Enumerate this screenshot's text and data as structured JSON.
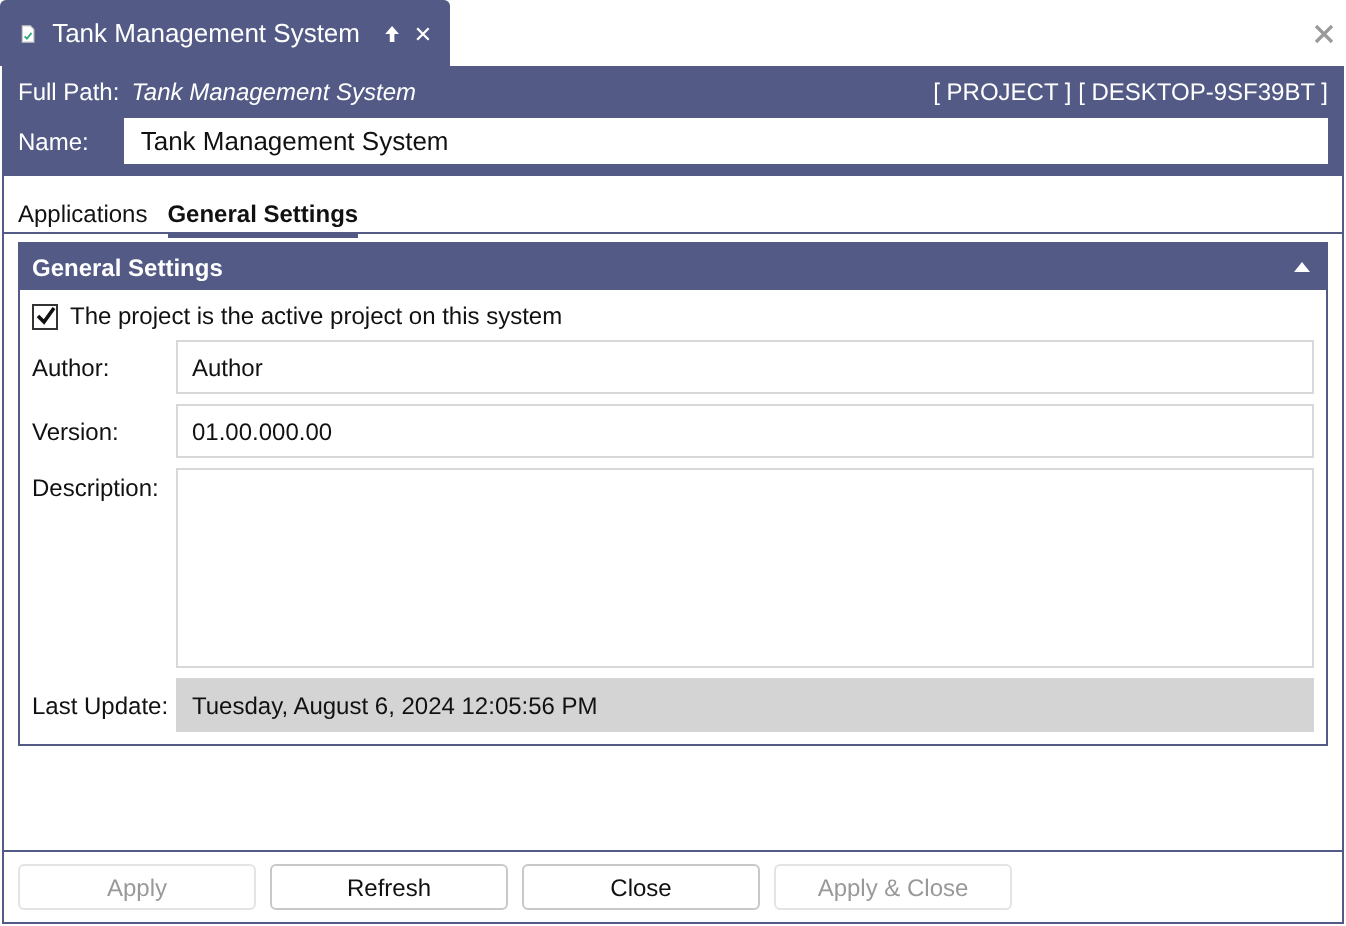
{
  "document_tab": {
    "title": "Tank Management System"
  },
  "header": {
    "full_path_label": "Full Path:",
    "full_path": "Tank Management System",
    "context": "[ PROJECT ] [ DESKTOP-9SF39BT ]",
    "name_label": "Name:",
    "name_value": "Tank Management System"
  },
  "tabs": [
    {
      "label": "Applications",
      "selected": false
    },
    {
      "label": "General Settings",
      "selected": true
    }
  ],
  "section": {
    "title": "General Settings",
    "expanded": true,
    "active_checkbox": {
      "label": "The project is the active project on this system",
      "checked": true
    },
    "fields": [
      {
        "kind": "text",
        "label": "Author:",
        "value": "Author"
      },
      {
        "kind": "text",
        "label": "Version:",
        "value": "01.00.000.00"
      },
      {
        "kind": "multiline",
        "label": "Description:"
      },
      {
        "kind": "readonly",
        "label": "Last Update:",
        "value": "Tuesday, August 6, 2024 12:05:56 PM"
      }
    ]
  },
  "buttons": [
    {
      "label": "Apply",
      "disabled": true
    },
    {
      "label": "Refresh",
      "disabled": false
    },
    {
      "label": "Close",
      "disabled": false
    },
    {
      "label": "Apply & Close",
      "disabled": true
    }
  ]
}
